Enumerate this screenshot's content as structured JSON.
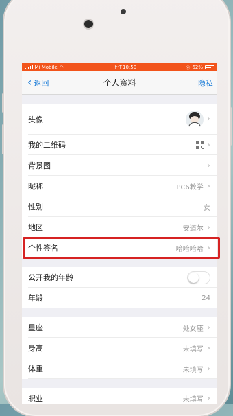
{
  "status_bar": {
    "carrier": "Mi Mobile",
    "time": "上午10:50",
    "battery": "62%",
    "background_color": "#f2541b"
  },
  "nav": {
    "back_label": "返回",
    "title": "个人资料",
    "right_label": "隐私",
    "accent_color": "#1a7cd8"
  },
  "profile": {
    "avatar_label": "头像",
    "qr_label": "我的二维码",
    "background_label": "背景图",
    "nickname_label": "昵称",
    "nickname_value": "PC6教学",
    "gender_label": "性别",
    "gender_value": "女",
    "region_label": "地区",
    "region_value": "安道尔",
    "signature_label": "个性签名",
    "signature_value": "哈哈哈哈"
  },
  "age": {
    "public_label": "公开我的年龄",
    "public_enabled": false,
    "age_label": "年龄",
    "age_value": "24"
  },
  "details": {
    "zodiac_label": "星座",
    "zodiac_value": "处女座",
    "height_label": "身高",
    "height_value": "未填写",
    "weight_label": "体重",
    "weight_value": "未填写",
    "job_label": "职业",
    "job_value": "未填写"
  },
  "icons": {
    "back": "chevron-left-icon",
    "disclosure": "chevron-right-icon",
    "qr": "qr-code-icon",
    "wifi": "wifi-icon",
    "battery": "battery-icon",
    "signal": "signal-icon"
  },
  "highlight_color": "#d62323"
}
